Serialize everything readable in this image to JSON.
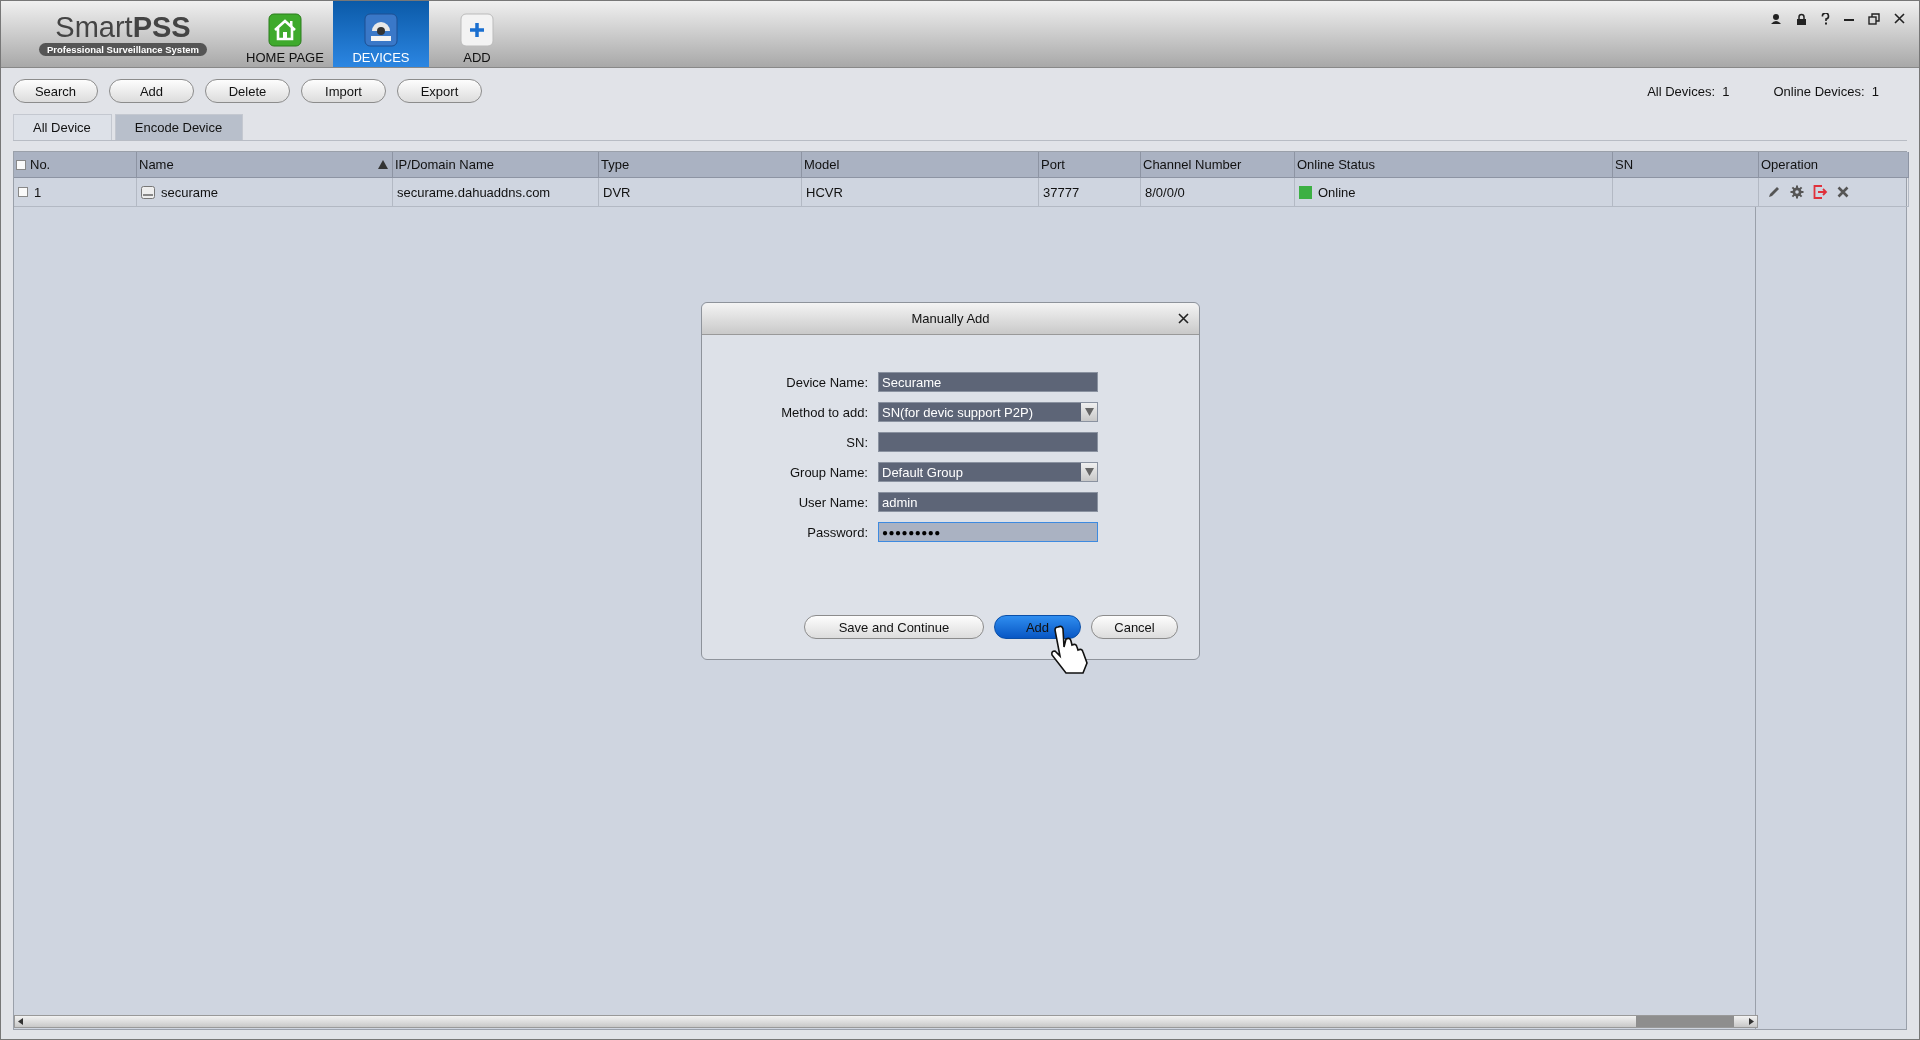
{
  "app": {
    "logo_name": "Smart",
    "logo_bold": "PSS",
    "logo_tagline": "Professional Surveillance System"
  },
  "nav_tabs": [
    {
      "label": "HOME PAGE",
      "kind": "home",
      "selected": false
    },
    {
      "label": "DEVICES",
      "kind": "devices",
      "selected": true
    },
    {
      "label": "ADD",
      "kind": "add",
      "selected": false
    }
  ],
  "window_controls": [
    {
      "kind": "user"
    },
    {
      "kind": "lock"
    },
    {
      "kind": "help"
    },
    {
      "kind": "minimize"
    },
    {
      "kind": "restore"
    },
    {
      "kind": "close"
    }
  ],
  "toolbar": {
    "buttons": [
      "Search",
      "Add",
      "Delete",
      "Import",
      "Export"
    ],
    "stats": [
      {
        "label": "All Devices:",
        "value": "1"
      },
      {
        "label": "Online Devices:",
        "value": "1"
      }
    ]
  },
  "sub_tabs": [
    {
      "label": "All Device",
      "selected": true
    },
    {
      "label": "Encode Device",
      "selected": false
    }
  ],
  "table": {
    "select_all_checked": false,
    "columns": [
      {
        "label": "No."
      },
      {
        "label": "Name",
        "sorted": true
      },
      {
        "label": "IP/Domain Name"
      },
      {
        "label": "Type"
      },
      {
        "label": "Model"
      },
      {
        "label": "Port"
      },
      {
        "label": "Channel Number"
      },
      {
        "label": "Online Status"
      },
      {
        "label": "SN"
      },
      {
        "label": "Operation"
      }
    ],
    "rows": [
      {
        "checked": false,
        "no": "1",
        "name": "securame",
        "ip": "securame.dahuaddns.com",
        "type": "DVR",
        "model": "HCVR",
        "port": "37777",
        "channels": "8/0/0/0",
        "status": "Online",
        "color": "#3cb043",
        "operations": [
          {
            "kind": "edit"
          },
          {
            "kind": "settings"
          },
          {
            "kind": "logout"
          },
          {
            "kind": "delete"
          }
        ]
      }
    ]
  },
  "dialog": {
    "title": "Manually Add",
    "fields": [
      {
        "label": "Device Name:",
        "kind": "text",
        "value": "Securame",
        "focused": false
      },
      {
        "label": "Method to add:",
        "kind": "select",
        "value": "SN(for devic support P2P)",
        "focused": false
      },
      {
        "label": "SN:",
        "kind": "text",
        "focused": false
      },
      {
        "label": "Group Name:",
        "kind": "select",
        "value": "Default Group",
        "focused": false
      },
      {
        "label": "User Name:",
        "kind": "text",
        "value": "admin",
        "focused": false
      },
      {
        "label": "Password:",
        "kind": "password",
        "value": "●●●●●●●●●",
        "focused": true
      }
    ],
    "buttons": [
      {
        "label": "Save and Continue",
        "primary": false
      },
      {
        "label": "Add",
        "primary": true
      },
      {
        "label": "Cancel",
        "primary": false
      }
    ]
  }
}
